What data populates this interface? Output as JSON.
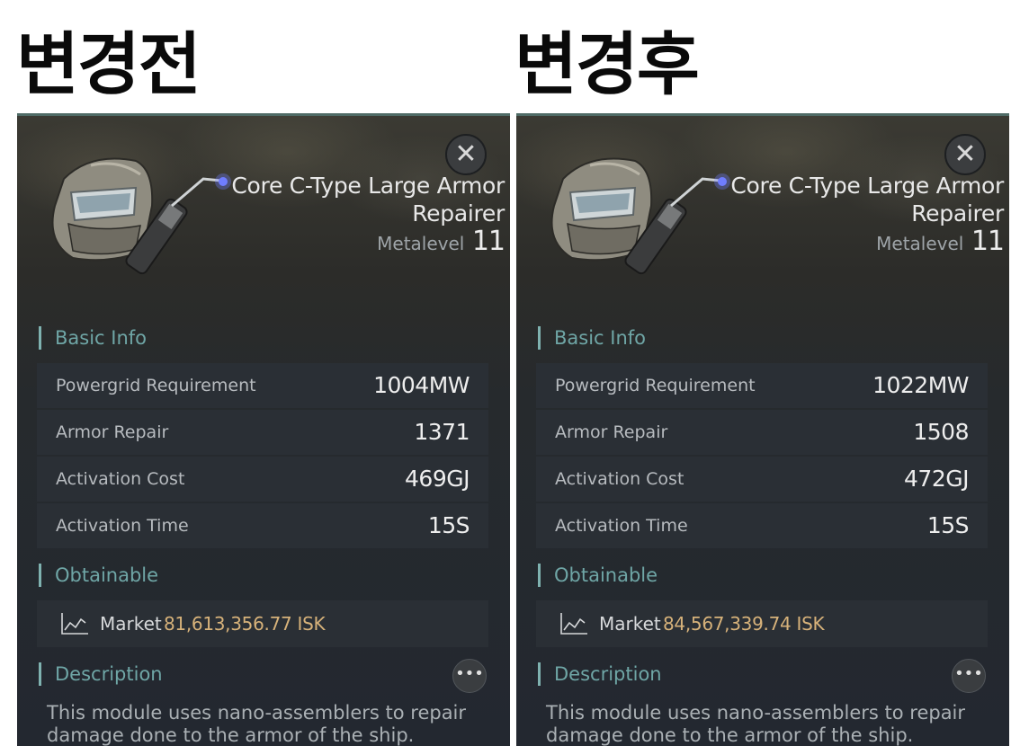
{
  "before": {
    "heading": "변경전",
    "item_name": "Core C-Type Large Armor Repairer",
    "metalevel_label": "Metalevel",
    "metalevel_value": "11",
    "close_icon": "close-icon",
    "sections": {
      "basic_info": "Basic Info",
      "obtainable": "Obtainable",
      "description": "Description"
    },
    "stats": [
      {
        "label": "Powergrid Requirement",
        "value": "1004MW"
      },
      {
        "label": "Armor Repair",
        "value": "1371"
      },
      {
        "label": "Activation Cost",
        "value": "469GJ"
      },
      {
        "label": "Activation Time",
        "value": "15S"
      }
    ],
    "market": {
      "icon": "chart-line-icon",
      "label": "Market",
      "price": "81,613,356.77 ISK"
    },
    "more_icon": "more-icon",
    "more_label": "•••",
    "description_text": "This module uses nano-assemblers to repair damage done to the armor of the ship."
  },
  "after": {
    "heading": "변경후",
    "item_name": "Core C-Type Large Armor Repairer",
    "metalevel_label": "Metalevel",
    "metalevel_value": "11",
    "close_icon": "close-icon",
    "sections": {
      "basic_info": "Basic Info",
      "obtainable": "Obtainable",
      "description": "Description"
    },
    "stats": [
      {
        "label": "Powergrid Requirement",
        "value": "1022MW"
      },
      {
        "label": "Armor Repair",
        "value": "1508"
      },
      {
        "label": "Activation Cost",
        "value": "472GJ"
      },
      {
        "label": "Activation Time",
        "value": "15S"
      }
    ],
    "market": {
      "icon": "chart-line-icon",
      "label": "Market",
      "price": "84,567,339.74 ISK"
    },
    "more_icon": "more-icon",
    "more_label": "•••",
    "description_text": "This module uses nano-assemblers to repair damage done to the armor of the ship."
  },
  "colors": {
    "accent": "#6fa6a6",
    "price": "#d7b27a",
    "panel": "#262a2d",
    "row": "#2a2f35"
  }
}
